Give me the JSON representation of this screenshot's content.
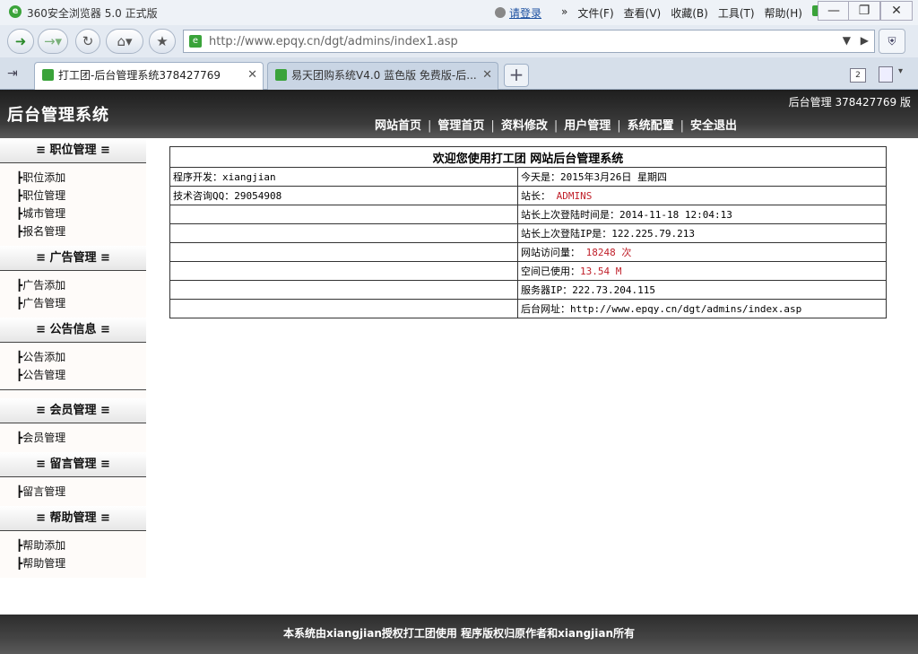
{
  "browser": {
    "title": "360安全浏览器 5.0 正式版",
    "menu": {
      "login": "请登录",
      "items": [
        "文件(F)",
        "查看(V)",
        "收藏(B)",
        "工具(T)",
        "帮助(H)"
      ]
    },
    "url": "http://www.epqy.cn/dgt/admins/index1.asp",
    "tabs": [
      {
        "label": "打工团-后台管理系统378427769"
      },
      {
        "label": "易天团购系统V4.0 蓝色版 免费版-后..."
      }
    ],
    "tab_count": "2"
  },
  "header": {
    "site_title": "后台管理系统",
    "user_info": "后台管理 378427769 版",
    "nav": [
      "网站首页",
      "管理首页",
      "资料修改",
      "用户管理",
      "系统配置",
      "安全退出"
    ]
  },
  "sidebar": {
    "sections": [
      {
        "title": "≡  职位管理  ≡",
        "items": [
          "┣职位添加",
          "┣职位管理",
          "┣城市管理",
          "┣报名管理"
        ]
      },
      {
        "title": "≡  广告管理  ≡",
        "items": [
          "┣广告添加",
          "┣广告管理"
        ]
      },
      {
        "title": "≡  公告信息  ≡",
        "items": [
          "┣公告添加",
          "┣公告管理"
        ]
      },
      {
        "title": "≡  会员管理  ≡",
        "items": [
          "┣会员管理"
        ]
      },
      {
        "title": "≡  留言管理  ≡",
        "items": [
          "┣留言管理"
        ]
      },
      {
        "title": "≡  帮助管理  ≡",
        "items": [
          "┣帮助添加",
          "┣帮助管理"
        ]
      }
    ]
  },
  "info": {
    "heading": "欢迎您使用打工团 网站后台管理系统",
    "developer": "程序开发：xiangjian",
    "qq": "技术咨询QQ：29054908",
    "today": "今天是：2015年3月26日 星期四",
    "admin_label": "站长：",
    "admin_value": "ADMINS",
    "last_login_time": "站长上次登陆时间是：2014-11-18 12:04:13",
    "last_login_ip": "站长上次登陆IP是：122.225.79.213",
    "visits_label": "网站访问量：",
    "visits_value": "18248 次",
    "space_label": "空间已使用：",
    "space_value": "13.54 M",
    "server_ip": "服务器IP：222.73.204.115",
    "backend_url": "后台网址：http://www.epqy.cn/dgt/admins/index.asp"
  },
  "footer": {
    "text": "本系统由xiangjian授权打工团使用 程序版权归原作者和xiangjian所有"
  },
  "colors": {
    "accent_red": "#c0202a",
    "header_dark": "#2a2a2a"
  }
}
